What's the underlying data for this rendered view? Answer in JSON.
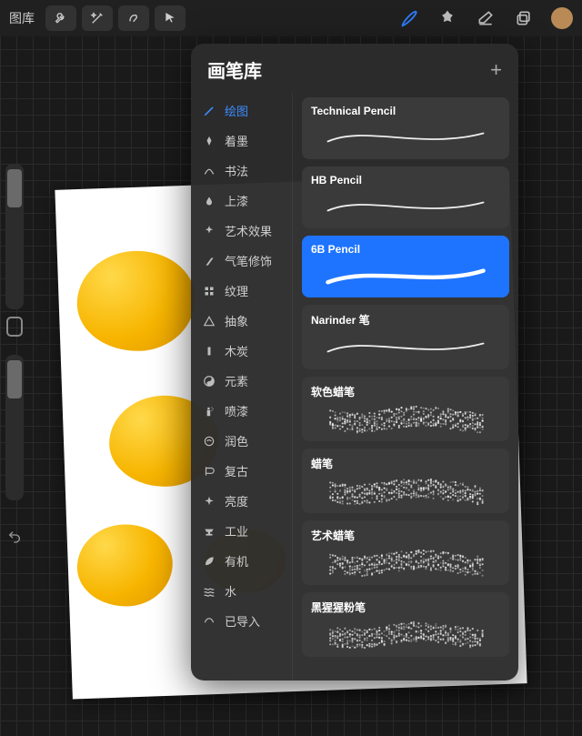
{
  "topbar": {
    "gallery": "图库",
    "color": "#b98a56"
  },
  "popover": {
    "title": "画笔库"
  },
  "categories": [
    {
      "icon": "pencil",
      "label": "绘图",
      "active": true
    },
    {
      "icon": "nib",
      "label": "着墨"
    },
    {
      "icon": "calligraphy",
      "label": "书法"
    },
    {
      "icon": "drop",
      "label": "上漆"
    },
    {
      "icon": "wand",
      "label": "艺术效果"
    },
    {
      "icon": "airbrush",
      "label": "气笔修饰"
    },
    {
      "icon": "texture",
      "label": "纹理"
    },
    {
      "icon": "triangle",
      "label": "抽象"
    },
    {
      "icon": "charcoal",
      "label": "木炭"
    },
    {
      "icon": "yinyang",
      "label": "元素"
    },
    {
      "icon": "spray",
      "label": "喷漆"
    },
    {
      "icon": "touchup",
      "label": "润色"
    },
    {
      "icon": "retro",
      "label": "复古"
    },
    {
      "icon": "sparkle",
      "label": "亮度"
    },
    {
      "icon": "anvil",
      "label": "工业"
    },
    {
      "icon": "leaf",
      "label": "有机"
    },
    {
      "icon": "waves",
      "label": "水"
    },
    {
      "icon": "import",
      "label": "已导入"
    }
  ],
  "brushes": [
    {
      "name": "Technical Pencil",
      "style": "thin",
      "selected": false
    },
    {
      "name": "HB Pencil",
      "style": "thin",
      "selected": false
    },
    {
      "name": "6B Pencil",
      "style": "med",
      "selected": true
    },
    {
      "name": "Narinder 笔",
      "style": "thin",
      "selected": false
    },
    {
      "name": "软色蜡笔",
      "style": "chalk",
      "selected": false
    },
    {
      "name": "蜡笔",
      "style": "chalk",
      "selected": false
    },
    {
      "name": "艺术蜡笔",
      "style": "chalk",
      "selected": false
    },
    {
      "name": "黑猩猩粉笔",
      "style": "chalk",
      "selected": false
    }
  ]
}
